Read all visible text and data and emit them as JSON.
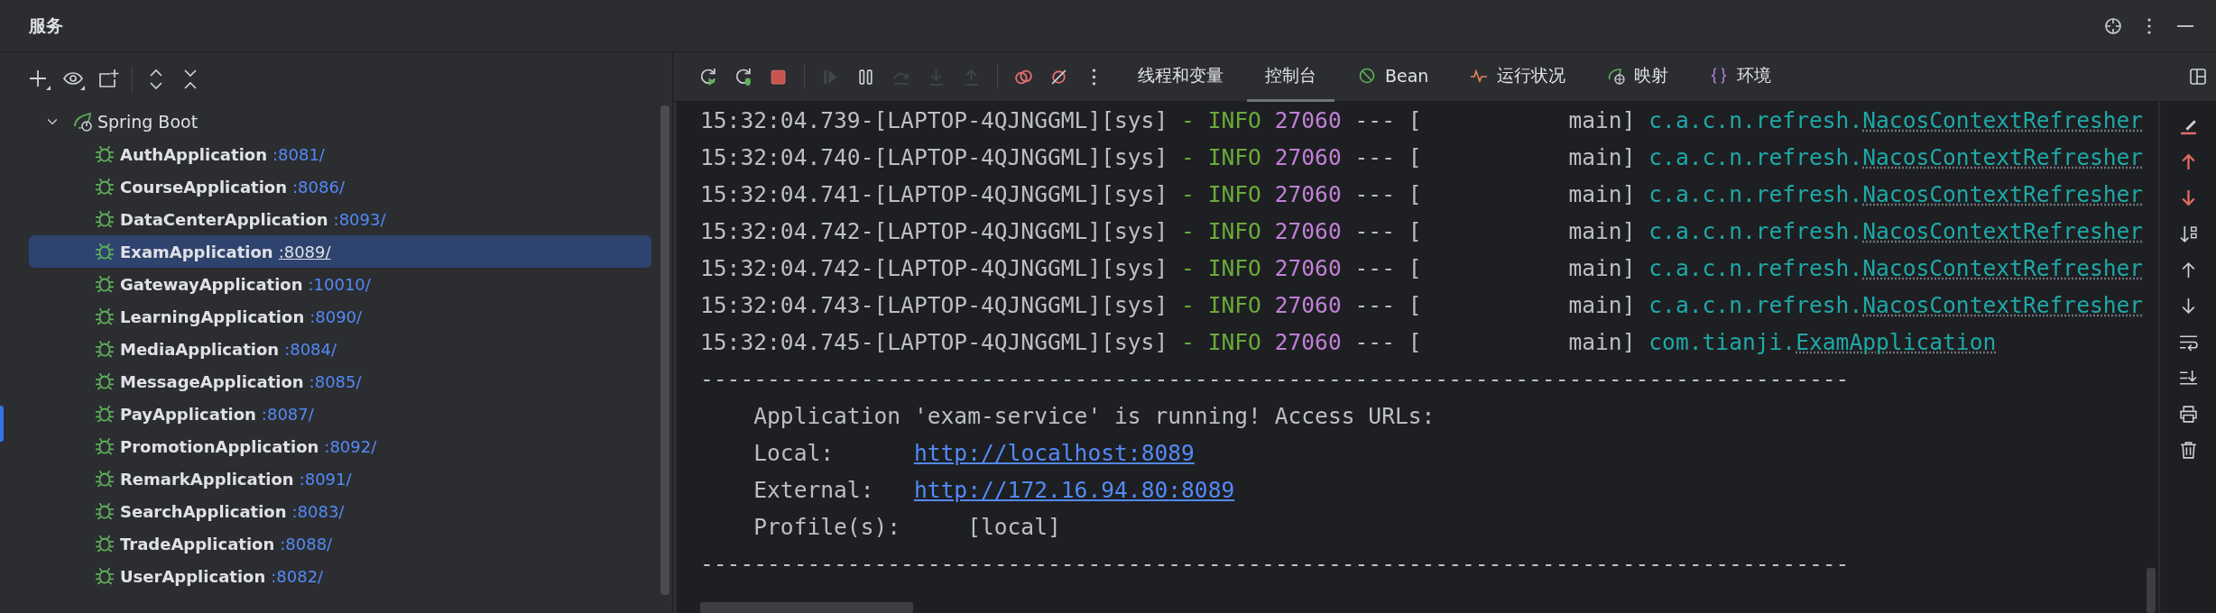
{
  "header": {
    "title": "服务"
  },
  "tree": {
    "label": "Spring Boot",
    "expanded": true,
    "children": [
      {
        "name": "AuthApplication",
        "port": ":8081/",
        "selected": false
      },
      {
        "name": "CourseApplication",
        "port": ":8086/",
        "selected": false
      },
      {
        "name": "DataCenterApplication",
        "port": ":8093/",
        "selected": false
      },
      {
        "name": "ExamApplication",
        "port": ":8089/",
        "selected": true
      },
      {
        "name": "GatewayApplication",
        "port": ":10010/",
        "selected": false
      },
      {
        "name": "LearningApplication",
        "port": ":8090/",
        "selected": false
      },
      {
        "name": "MediaApplication",
        "port": ":8084/",
        "selected": false
      },
      {
        "name": "MessageApplication",
        "port": ":8085/",
        "selected": false
      },
      {
        "name": "PayApplication",
        "port": ":8087/",
        "selected": false
      },
      {
        "name": "PromotionApplication",
        "port": ":8092/",
        "selected": false
      },
      {
        "name": "RemarkApplication",
        "port": ":8091/",
        "selected": false
      },
      {
        "name": "SearchApplication",
        "port": ":8083/",
        "selected": false
      },
      {
        "name": "TradeApplication",
        "port": ":8088/",
        "selected": false
      },
      {
        "name": "UserApplication",
        "port": ":8082/",
        "selected": false
      }
    ]
  },
  "console_toolbar": {
    "actions": [
      {
        "kind": "rerun",
        "disabled": false
      },
      {
        "kind": "rerun-debug",
        "disabled": false
      },
      {
        "kind": "stop",
        "disabled": false
      },
      {
        "kind": "separator"
      },
      {
        "kind": "resume",
        "disabled": true
      },
      {
        "kind": "pause",
        "disabled": false
      },
      {
        "kind": "step-over",
        "disabled": true
      },
      {
        "kind": "step-into",
        "disabled": true
      },
      {
        "kind": "step-out",
        "disabled": true
      },
      {
        "kind": "separator"
      },
      {
        "kind": "breakpoints",
        "disabled": false
      },
      {
        "kind": "mute",
        "disabled": false
      },
      {
        "kind": "more",
        "disabled": false
      }
    ],
    "tabs": [
      {
        "label": "线程和变量",
        "kind": "plain",
        "selected": false
      },
      {
        "label": "控制台",
        "kind": "plain",
        "selected": true
      },
      {
        "label": "Bean",
        "kind": "bean",
        "selected": false
      },
      {
        "label": "运行状况",
        "kind": "health",
        "selected": false
      },
      {
        "label": "映射",
        "kind": "mapping",
        "selected": false
      },
      {
        "label": "环境",
        "kind": "env",
        "selected": false
      }
    ]
  },
  "console": {
    "lines": [
      {
        "segments": [
          {
            "kind": "plain",
            "text": "15:32:04.739-[LAPTOP-4QJNGGML][sys] "
          },
          {
            "kind": "level",
            "text": "- INFO"
          },
          {
            "kind": "pid",
            "text": " 27060"
          },
          {
            "kind": "plain",
            "text": " --- [           main] "
          },
          {
            "kind": "pkg",
            "text": "c.a.c.n.refresh."
          },
          {
            "kind": "class",
            "text": "NacosContextRefresher"
          }
        ]
      },
      {
        "segments": [
          {
            "kind": "plain",
            "text": "15:32:04.740-[LAPTOP-4QJNGGML][sys] "
          },
          {
            "kind": "level",
            "text": "- INFO"
          },
          {
            "kind": "pid",
            "text": " 27060"
          },
          {
            "kind": "plain",
            "text": " --- [           main] "
          },
          {
            "kind": "pkg",
            "text": "c.a.c.n.refresh."
          },
          {
            "kind": "class",
            "text": "NacosContextRefresher"
          }
        ]
      },
      {
        "segments": [
          {
            "kind": "plain",
            "text": "15:32:04.741-[LAPTOP-4QJNGGML][sys] "
          },
          {
            "kind": "level",
            "text": "- INFO"
          },
          {
            "kind": "pid",
            "text": " 27060"
          },
          {
            "kind": "plain",
            "text": " --- [           main] "
          },
          {
            "kind": "pkg",
            "text": "c.a.c.n.refresh."
          },
          {
            "kind": "class",
            "text": "NacosContextRefresher"
          }
        ]
      },
      {
        "segments": [
          {
            "kind": "plain",
            "text": "15:32:04.742-[LAPTOP-4QJNGGML][sys] "
          },
          {
            "kind": "level",
            "text": "- INFO"
          },
          {
            "kind": "pid",
            "text": " 27060"
          },
          {
            "kind": "plain",
            "text": " --- [           main] "
          },
          {
            "kind": "pkg",
            "text": "c.a.c.n.refresh."
          },
          {
            "kind": "class",
            "text": "NacosContextRefresher"
          }
        ]
      },
      {
        "segments": [
          {
            "kind": "plain",
            "text": "15:32:04.742-[LAPTOP-4QJNGGML][sys] "
          },
          {
            "kind": "level",
            "text": "- INFO"
          },
          {
            "kind": "pid",
            "text": " 27060"
          },
          {
            "kind": "plain",
            "text": " --- [           main] "
          },
          {
            "kind": "pkg",
            "text": "c.a.c.n.refresh."
          },
          {
            "kind": "class",
            "text": "NacosContextRefresher"
          }
        ]
      },
      {
        "segments": [
          {
            "kind": "plain",
            "text": "15:32:04.743-[LAPTOP-4QJNGGML][sys] "
          },
          {
            "kind": "level",
            "text": "- INFO"
          },
          {
            "kind": "pid",
            "text": " 27060"
          },
          {
            "kind": "plain",
            "text": " --- [           main] "
          },
          {
            "kind": "pkg",
            "text": "c.a.c.n.refresh."
          },
          {
            "kind": "class",
            "text": "NacosContextRefresher"
          }
        ]
      },
      {
        "segments": [
          {
            "kind": "plain",
            "text": "15:32:04.745-[LAPTOP-4QJNGGML][sys] "
          },
          {
            "kind": "level",
            "text": "- INFO"
          },
          {
            "kind": "pid",
            "text": " 27060"
          },
          {
            "kind": "plain",
            "text": " --- [           main] "
          },
          {
            "kind": "pkg",
            "text": "com.tianji."
          },
          {
            "kind": "class",
            "text": "ExamApplication"
          }
        ]
      },
      {
        "segments": [
          {
            "kind": "plain",
            "text": "--------------------------------------------------------------------------------------"
          }
        ]
      },
      {
        "segments": [
          {
            "kind": "plain",
            "text": "    Application 'exam-service' is running! Access URLs:"
          }
        ]
      },
      {
        "segments": [
          {
            "kind": "plain",
            "text": "    Local:      "
          },
          {
            "kind": "link",
            "text": "http://localhost:8089"
          }
        ]
      },
      {
        "segments": [
          {
            "kind": "plain",
            "text": "    External:   "
          },
          {
            "kind": "link",
            "text": "http://172.16.94.80:8089"
          }
        ]
      },
      {
        "segments": [
          {
            "kind": "plain",
            "text": "    Profile(s):     [local]"
          }
        ]
      },
      {
        "segments": [
          {
            "kind": "plain",
            "text": "--------------------------------------------------------------------------------------"
          }
        ]
      }
    ]
  }
}
